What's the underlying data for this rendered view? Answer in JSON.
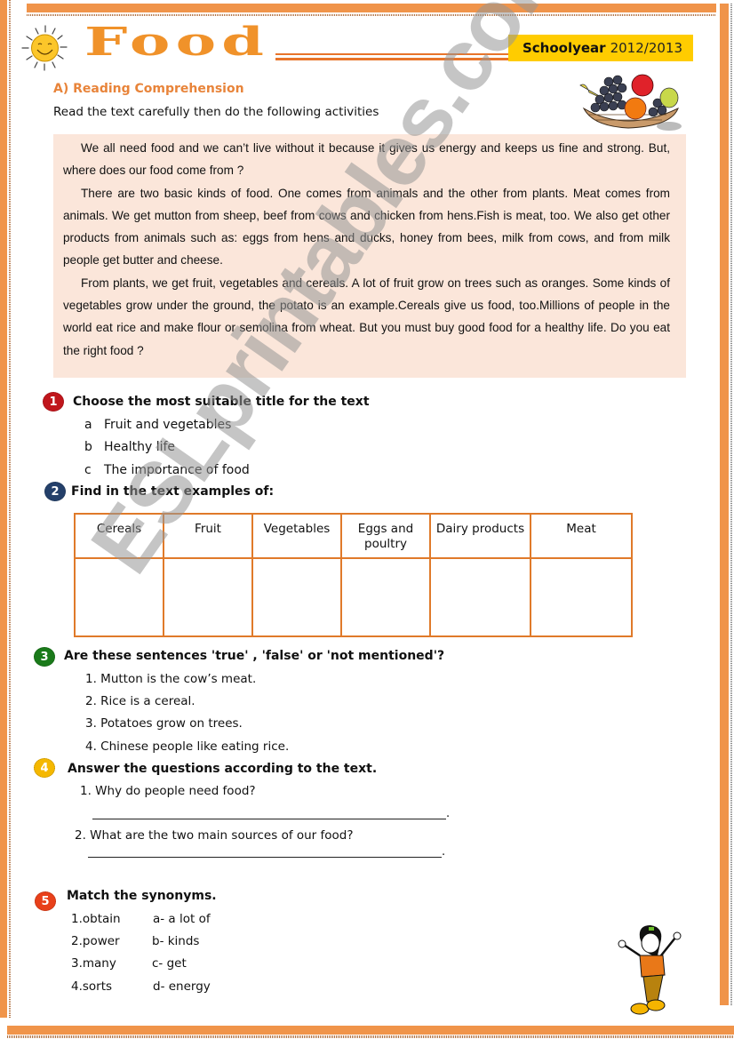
{
  "header": {
    "title": "Food",
    "schoolyear_label": "Schoolyear",
    "schoolyear_value": "2012/2013"
  },
  "section": {
    "heading": "A) Reading Comprehension",
    "instructions": "Read the text carefully then do the following activities"
  },
  "passage": {
    "paragraphs": [
      "We all need food and we can’t live without it because it gives us energy and keeps us fine and strong. But, where does our food come from ?",
      "There are two basic kinds of food. One comes from animals  and the other from plants. Meat comes from animals. We get mutton from sheep, beef from cows  and chicken from hens.Fish is meat, too. We also get other products  from animals such as: eggs from hens and ducks, honey from bees, milk from cows, and from milk people get butter and cheese.",
      "From plants, we get fruit, vegetables and cereals. A lot of fruit grow on trees such as oranges. Some kinds of vegetables grow under the ground, the potato is an example.Cereals give us food, too.Millions of people in the world eat rice and make flour or semolina from wheat. But you must buy good food for a healthy life. Do you eat the right food ?"
    ]
  },
  "q1": {
    "number": "1",
    "color": "#c0161c",
    "title": "Choose the most suitable title for the text",
    "options": [
      {
        "letter": "a",
        "text": "Fruit and vegetables"
      },
      {
        "letter": "b",
        "text": "Healthy life"
      },
      {
        "letter": "c",
        "text": "The importance of food"
      }
    ]
  },
  "q2": {
    "number": "2",
    "color": "#24406a",
    "title": "Find in the text examples of:",
    "columns": [
      "Cereals",
      "Fruit",
      "Vegetables",
      "Eggs and poultry",
      "Dairy products",
      "Meat"
    ]
  },
  "q3": {
    "number": "3",
    "color": "#1a7a1a",
    "title": "Are these sentences 'true' , 'false' or 'not mentioned'?",
    "items": [
      "1. Mutton is the cow’s meat.",
      "2. Rice is a cereal.",
      "3. Potatoes grow on trees.",
      "4. Chinese people like eating rice."
    ]
  },
  "q4": {
    "number": "4",
    "color": "#f5b800",
    "title": "Answer the questions according to the text.",
    "questions": [
      "1. Why do people need food?",
      "2. What are the two main sources of our food?"
    ],
    "line_end": "."
  },
  "q5": {
    "number": "5",
    "color": "#e8401a",
    "title": "Match the synonyms.",
    "left": [
      "1.obtain",
      "2.power",
      "3.many",
      "4.sorts"
    ],
    "right": [
      "a- a lot of",
      "b- kinds",
      "c- get",
      "d- energy"
    ]
  },
  "watermark": "ESLprintables.com"
}
